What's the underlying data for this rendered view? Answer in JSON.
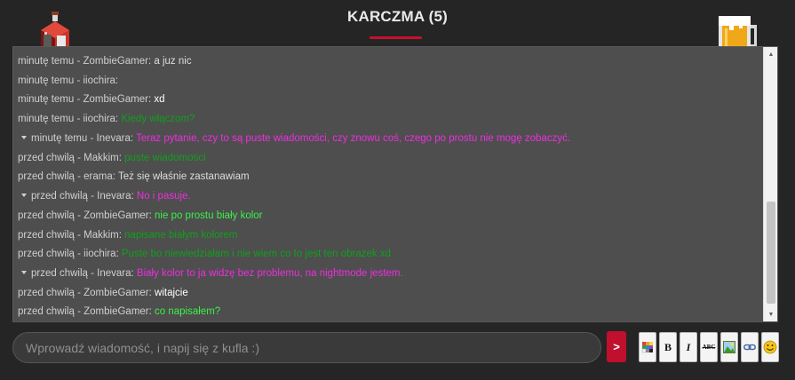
{
  "header": {
    "title": "KARCZMA (5)"
  },
  "messages": [
    {
      "meta": "minutę temu - ZombieGamer:",
      "text": "a juz nic",
      "color": "gray",
      "collapsible": false
    },
    {
      "meta": "minutę temu - iiochira:",
      "text": "",
      "color": "gray",
      "collapsible": false
    },
    {
      "meta": "minutę temu - ZombieGamer:",
      "text": "xd",
      "color": "white",
      "collapsible": false
    },
    {
      "meta": "minutę temu - iiochira:",
      "text": "Kiedy włączom?",
      "color": "green",
      "collapsible": false
    },
    {
      "meta": "minutę temu - Inevara:",
      "text": "Teraz pytanie, czy to są puste wiadomości, czy znowu coś, czego po prostu nie mogę zobaczyć.",
      "color": "magenta",
      "collapsible": true
    },
    {
      "meta": "przed chwilą - Makkim:",
      "text": "puste wiadomosci",
      "color": "green",
      "collapsible": false
    },
    {
      "meta": "przed chwilą - erama:",
      "text": "Też się właśnie zastanawiam",
      "color": "gray",
      "collapsible": false
    },
    {
      "meta": "przed chwilą - Inevara:",
      "text": "No i pasuje.",
      "color": "magenta",
      "collapsible": true
    },
    {
      "meta": "przed chwilą - ZombieGamer:",
      "text": "nie po prostu biały kolor",
      "color": "bright-green",
      "collapsible": false
    },
    {
      "meta": "przed chwilą - Makkim:",
      "text": "napisane białym kolorem",
      "color": "green",
      "collapsible": false
    },
    {
      "meta": "przed chwilą - iiochira:",
      "text": "Puste bo niewiedziałam i nie wiem co to jest ten obrazek xd",
      "color": "green",
      "collapsible": false
    },
    {
      "meta": "przed chwilą - Inevara:",
      "text": "Biały kolor to ja widzę bez problemu, na nightmode jestem.",
      "color": "magenta",
      "collapsible": true
    },
    {
      "meta": "przed chwilą - ZombieGamer:",
      "text": "witajcie",
      "color": "white",
      "collapsible": false
    },
    {
      "meta": "przed chwilą - ZombieGamer:",
      "text": "co napisałem?",
      "color": "bright-green",
      "collapsible": false
    }
  ],
  "composer": {
    "placeholder": "Wprowadź wiadomość, i napij się z kufla :)",
    "value": "",
    "send_label": ">"
  },
  "toolbar": {
    "bold_label": "B",
    "italic_label": "I",
    "strike_label": "ABC",
    "tools": [
      "color-palette",
      "bold",
      "italic",
      "strikethrough",
      "image",
      "link",
      "emoji"
    ]
  },
  "colors": {
    "accent": "#c0102e",
    "green": "#10a01c",
    "bright_green": "#3bf04a",
    "magenta": "#ee2ee0",
    "white": "#ffffff",
    "gray": "#dcdcdc"
  }
}
